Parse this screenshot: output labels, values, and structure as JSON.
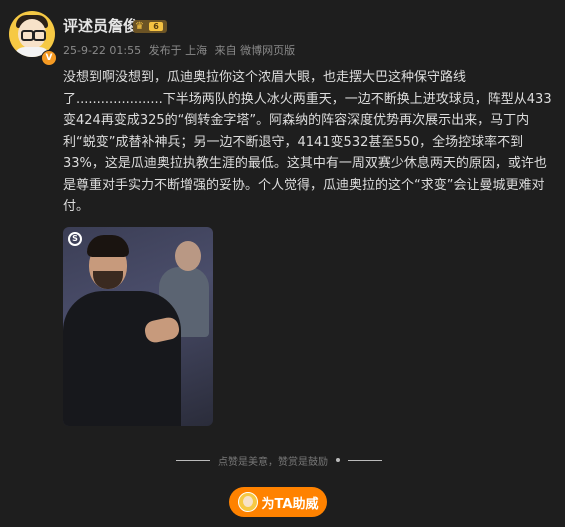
{
  "author": {
    "name": "评述员詹俊",
    "avatar_icon": "cartoon-avatar-icon",
    "verified_badge": "V",
    "level_badge": "6"
  },
  "meta": {
    "time": "25-9-22 01:55",
    "location": "发布于 上海",
    "source": "来自 微博网页版"
  },
  "post": {
    "text": "没想到啊没想到，瓜迪奥拉你这个浓眉大眼，也走摆大巴这种保守路线了.....................下半场两队的换人冰火两重天，一边不断换上进攻球员，阵型从433变424再变成325的“倒转金字塔”。阿森纳的阵容深度优势再次展示出来，马丁内利“蜕变”成替补神兵；另一边不断退守，4141变532甚至550，全场控球率不到33%，这是瓜迪奥拉执教生涯的最低。这其中有一周双赛少休息两天的原因，或许也是尊重对手实力不断增强的妥协。个人觉得，瓜迪奥拉的这个“求变”会让曼城更难对付。",
    "image_logo": "S"
  },
  "footer": {
    "slogan": "点赞是美意，赞赏是鼓励",
    "reward_button_label": "为TA助威"
  }
}
